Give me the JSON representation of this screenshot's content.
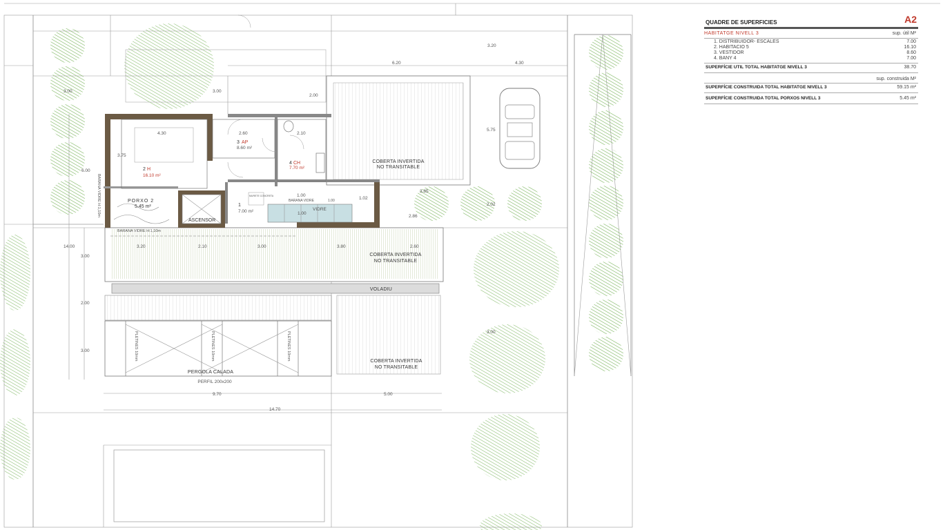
{
  "schedule": {
    "title": "QUADRE DE SUPERFICIES",
    "code": "A2",
    "section": "HABITATGE NIVELL 3",
    "unit_useful": "sup. útil M²",
    "rooms": [
      {
        "label": "1. DISTRIBUIDOR- ESCALES",
        "area": "7.00"
      },
      {
        "label": "2. HABITACIO 5",
        "area": "16.10"
      },
      {
        "label": "3. VESTIDOR",
        "area": "8.60"
      },
      {
        "label": "4. BANY 4",
        "area": "7.00"
      }
    ],
    "useful_total_label": "SUPERFÍCIE UTIL TOTAL HABITATGE NIVELL 3",
    "useful_total": "38.70",
    "unit_built": "sup. construida M²",
    "built_total_label": "SUPERFÍCIE CONSTRUIDA TOTAL HABITATGE NIVELL 3",
    "built_total": "59.15 m²",
    "porch_total_label": "SUPERFÍCIE CONSTRUIDA TOTAL PORXOS NIVELL 3",
    "porch_total": "5.45 m²"
  },
  "plan": {
    "rooms": {
      "h2_num": "2",
      "h2_code": "H",
      "h2_area": "16.10 m²",
      "ap3_num": "3",
      "ap3_code": "AP",
      "ap3_area": "8.60 m²",
      "ch4_num": "4",
      "ch4_code": "CH",
      "ch4_area": "7.70 m²",
      "d1_num": "1",
      "d1_area": "7.00 m²",
      "porch_name": "PORXO 2",
      "porch_area": "5.45 m²",
      "lift": "ASCENSOR",
      "glass": "VIDRE",
      "stair_note": "BARANA VIDRE",
      "stair_note_value": "1.00",
      "hole_note": "MURETE CONCRETA"
    },
    "zones": {
      "roof_line1": "COBERTA INVERTIDA",
      "roof_line2": "NO TRANSITABLE",
      "overhang": "VOLADIU",
      "pergola": "PERGOLA  CALADA",
      "profile": "PERFIL  200x200",
      "slats": "PLETINES 10mm",
      "rail_vertical": "BARANA VIDRE H:1,10m",
      "rail_horizontal": "BARANA VIDRE H:1,10m"
    },
    "dims": {
      "d320": "3.20",
      "d620": "6.20",
      "d430": "4.30",
      "d300": "3.00",
      "d200": "2.00",
      "d575": "5.75",
      "d600": "6.00",
      "d375": "3.75",
      "d260": "2.60",
      "d210": "2.10",
      "d100": "1.00",
      "d102": "1.02",
      "d286": "2.86",
      "d1400": "14.00",
      "d380": "3.80",
      "d970": "9.70",
      "d500": "5.00",
      "d1470": "14.70",
      "d385": "3.85",
      "d202": "2.02"
    }
  }
}
